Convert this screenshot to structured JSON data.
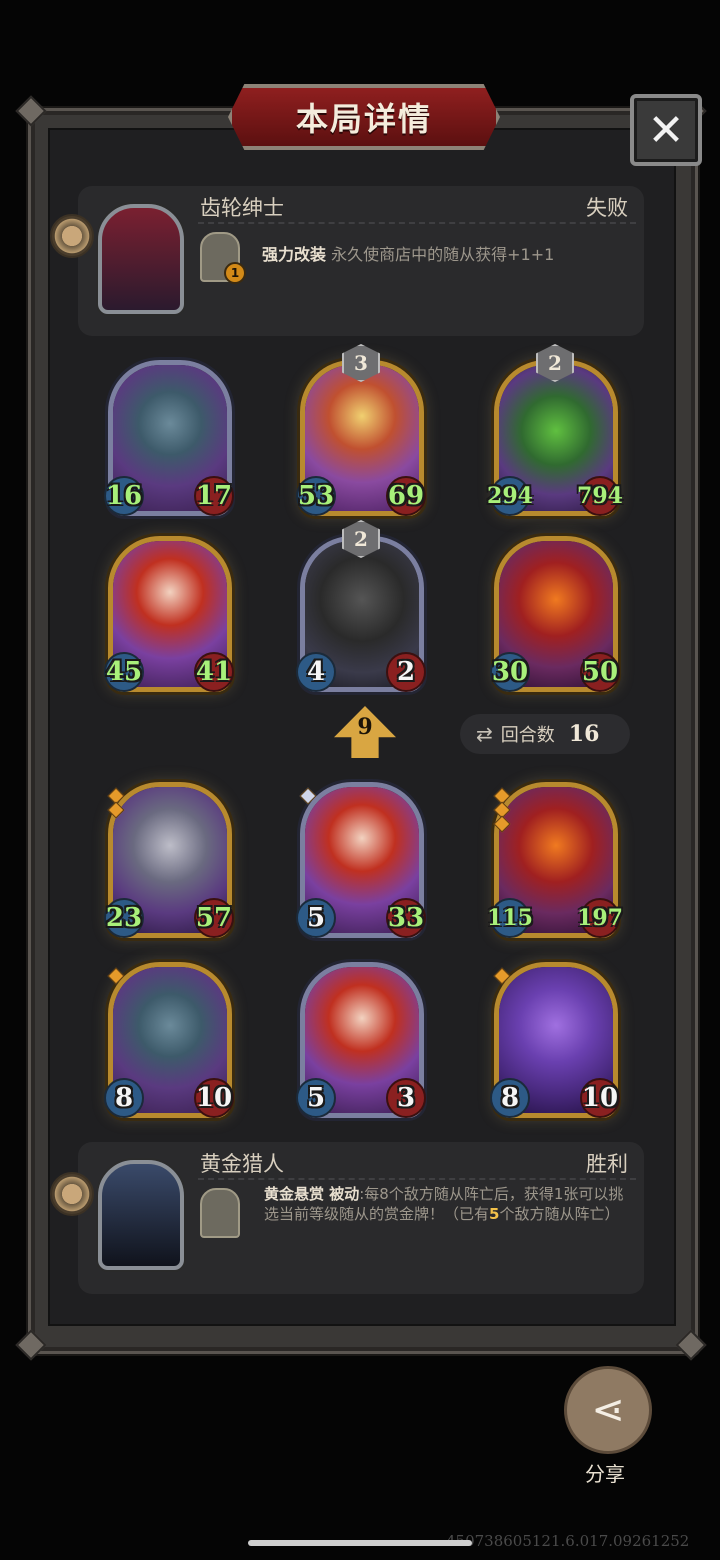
{
  "title": "本局详情",
  "close_label": "✕",
  "opponent": {
    "name": "齿轮绅士",
    "result": "失败",
    "hero_power_badge": "1",
    "ability_name": "强力改装",
    "ability_desc": " 永久使商店中的随从获得+1+1"
  },
  "player": {
    "name": "黄金猎人",
    "result": "胜利",
    "ability_name": "黄金悬赏",
    "ability_type": " 被动",
    "ability_desc_1": ":每8个敌方随从阵亡后，获得1张可以挑选当前等级随从的赏金牌！（已有",
    "ability_highlight": "5",
    "ability_desc_2": "个敌方随从阵亡）"
  },
  "level": "9",
  "turns": {
    "label": "回合数",
    "value": "16"
  },
  "share_label": "分享",
  "watermark": "450738605121.6.017.09261252",
  "opponent_board": [
    {
      "tier": "",
      "attack": "16",
      "health": "17",
      "frame": "silver",
      "art": "bat-demon"
    },
    {
      "tier": "3",
      "attack": "53",
      "health": "69",
      "frame": "gold",
      "art": "ram-demon"
    },
    {
      "tier": "2",
      "attack": "294",
      "health": "794",
      "frame": "gold",
      "art": "green-dragon"
    },
    {
      "tier": "",
      "attack": "45",
      "health": "41",
      "frame": "gold",
      "art": "red-hair-girl"
    },
    {
      "tier": "2",
      "attack": "4",
      "health": "2",
      "frame": "silver",
      "art": "shield-knight"
    },
    {
      "tier": "",
      "attack": "30",
      "health": "50",
      "frame": "gold",
      "art": "fire-demon"
    }
  ],
  "player_board": [
    {
      "gems": 2,
      "attack": "23",
      "health": "57",
      "frame": "gold",
      "art": "grey-dragon"
    },
    {
      "gems": 1,
      "attack": "5",
      "health": "33",
      "frame": "silver",
      "art": "red-hair-girl"
    },
    {
      "gems": 3,
      "attack": "115",
      "health": "197",
      "frame": "gold",
      "art": "fire-demon"
    },
    {
      "gems": 1,
      "attack": "8",
      "health": "10",
      "frame": "gold",
      "art": "bat-demon"
    },
    {
      "gems": 0,
      "attack": "5",
      "health": "3",
      "frame": "silver",
      "art": "red-hair-girl"
    },
    {
      "gems": 1,
      "attack": "8",
      "health": "10",
      "frame": "gold",
      "art": "purple-dragon"
    }
  ],
  "colors": {
    "gold_frame": "#b88a2e",
    "silver_frame": "#7b7fa0",
    "attack": "#2d5a86",
    "health": "#8a2020",
    "buff_text": "#a8f07a",
    "title_red": "#8f1f1f"
  }
}
